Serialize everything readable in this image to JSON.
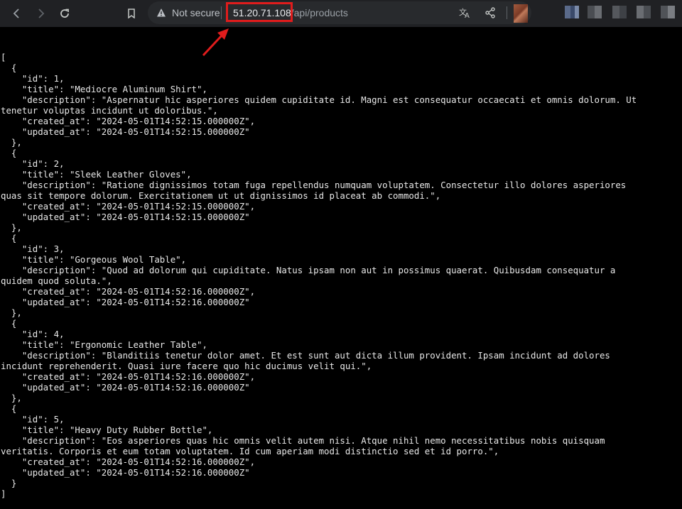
{
  "browser": {
    "security_label": "Not secure",
    "url_host": "51.20.71.108",
    "url_path": "/api/products",
    "icons": {
      "back": "back-arrow-icon",
      "forward": "forward-arrow-icon",
      "reload": "reload-icon",
      "bookmark": "bookmark-icon",
      "warning": "warning-icon",
      "translate": "translate-icon",
      "share": "share-icon"
    }
  },
  "annotation": {
    "highlight_color": "#e01c1c"
  },
  "json_lines": [
    "[",
    "  {",
    "    \"id\": 1,",
    "    \"title\": \"Mediocre Aluminum Shirt\",",
    "    \"description\": \"Aspernatur hic asperiores quidem cupiditate id. Magni est consequatur occaecati et omnis dolorum. Ut",
    "tenetur voluptas incidunt ut doloribus.\",",
    "    \"created_at\": \"2024-05-01T14:52:15.000000Z\",",
    "    \"updated_at\": \"2024-05-01T14:52:15.000000Z\"",
    "  },",
    "  {",
    "    \"id\": 2,",
    "    \"title\": \"Sleek Leather Gloves\",",
    "    \"description\": \"Ratione dignissimos totam fuga repellendus numquam voluptatem. Consectetur illo dolores asperiores",
    "quas sit tempore dolorum. Exercitationem ut ut dignissimos id placeat ab commodi.\",",
    "    \"created_at\": \"2024-05-01T14:52:15.000000Z\",",
    "    \"updated_at\": \"2024-05-01T14:52:15.000000Z\"",
    "  },",
    "  {",
    "    \"id\": 3,",
    "    \"title\": \"Gorgeous Wool Table\",",
    "    \"description\": \"Quod ad dolorum qui cupiditate. Natus ipsam non aut in possimus quaerat. Quibusdam consequatur a",
    "quidem quod soluta.\",",
    "    \"created_at\": \"2024-05-01T14:52:16.000000Z\",",
    "    \"updated_at\": \"2024-05-01T14:52:16.000000Z\"",
    "  },",
    "  {",
    "    \"id\": 4,",
    "    \"title\": \"Ergonomic Leather Table\",",
    "    \"description\": \"Blanditiis tenetur dolor amet. Et est sunt aut dicta illum provident. Ipsam incidunt ad dolores",
    "incidunt reprehenderit. Quasi iure facere quo hic ducimus velit qui.\",",
    "    \"created_at\": \"2024-05-01T14:52:16.000000Z\",",
    "    \"updated_at\": \"2024-05-01T14:52:16.000000Z\"",
    "  },",
    "  {",
    "    \"id\": 5,",
    "    \"title\": \"Heavy Duty Rubber Bottle\",",
    "    \"description\": \"Eos asperiores quas hic omnis velit autem nisi. Atque nihil nemo necessitatibus nobis quisquam",
    "veritatis. Corporis et eum totam voluptatem. Id cum aperiam modi distinctio sed et id porro.\",",
    "    \"created_at\": \"2024-05-01T14:52:16.000000Z\",",
    "    \"updated_at\": \"2024-05-01T14:52:16.000000Z\"",
    "  }",
    "]"
  ]
}
